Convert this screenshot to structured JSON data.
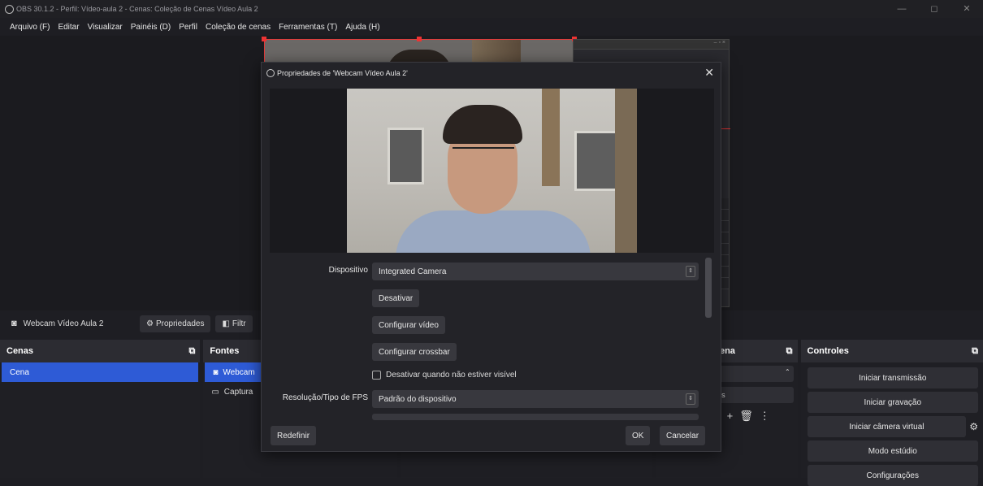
{
  "window": {
    "title": "OBS 30.1.2 - Perfil: Vídeo-aula 2 - Cenas: Coleção de Cenas Vídeo Aula 2"
  },
  "menu": [
    "Arquivo (F)",
    "Editar",
    "Visualizar",
    "Painéis (D)",
    "Perfil",
    "Coleção de cenas",
    "Ferramentas (T)",
    "Ajuda (H)"
  ],
  "source_bar": {
    "source_name": "Webcam Vídeo Aula 2",
    "properties_label": "Propriedades",
    "filters_label": "Filtr"
  },
  "docks": {
    "scenes": {
      "title": "Cenas",
      "items": [
        "Cena"
      ]
    },
    "sources": {
      "title": "Fontes",
      "items": [
        "Webcam",
        "Captura"
      ]
    },
    "transitions": {
      "title": "e cena",
      "duration_text": "ms"
    },
    "controls": {
      "title": "Controles",
      "buttons": [
        "Iniciar transmissão",
        "Iniciar gravação",
        "Iniciar câmera virtual",
        "Modo estúdio",
        "Configurações"
      ]
    }
  },
  "dialog": {
    "title": "Propriedades de 'Webcam Vídeo Aula 2'",
    "device_label": "Dispositivo",
    "device_value": "Integrated Camera",
    "deactivate_button": "Desativar",
    "configure_video_button": "Configurar vídeo",
    "configure_crossbar_button": "Configurar crossbar",
    "deactivate_when_hidden_label": "Desativar quando não estiver visível",
    "fps_label": "Resolução/Tipo de FPS",
    "fps_value": "Padrão do dispositivo",
    "reset_button": "Redefinir",
    "ok_button": "OK",
    "cancel_button": "Cancelar"
  },
  "colors": {
    "accent_selection": "#2e5bd6",
    "selection_border": "#e23b3b"
  }
}
